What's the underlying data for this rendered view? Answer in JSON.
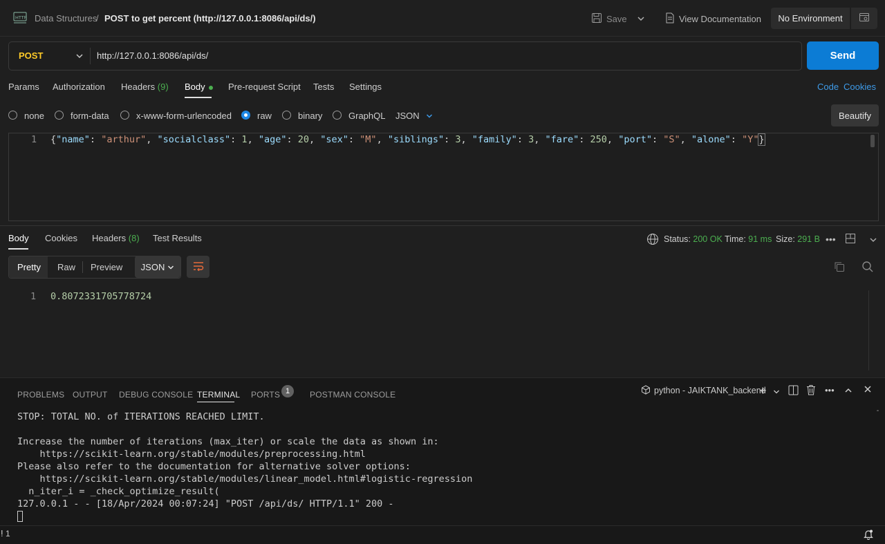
{
  "header": {
    "collection": "Data Structures",
    "separator": "/",
    "request_name": "POST to get percent (http://127.0.0.1:8086/api/ds/)",
    "save_label": "Save",
    "view_docs_label": "View Documentation",
    "environment": "No Environment"
  },
  "request": {
    "method": "POST",
    "url": "http://127.0.0.1:8086/api/ds/",
    "send_label": "Send"
  },
  "request_tabs": {
    "params": "Params",
    "authorization": "Authorization",
    "headers": "Headers",
    "headers_count": "(9)",
    "body": "Body",
    "prerequest": "Pre-request Script",
    "tests": "Tests",
    "settings": "Settings",
    "code": "Code",
    "cookies": "Cookies"
  },
  "body_types": {
    "none": "none",
    "form_data": "form-data",
    "urlencoded": "x-www-form-urlencoded",
    "raw": "raw",
    "binary": "binary",
    "graphql": "GraphQL",
    "format": "JSON",
    "beautify": "Beautify"
  },
  "editor": {
    "line_number": "1",
    "body": {
      "name": "arthur",
      "socialclass": 1,
      "age": 20,
      "sex": "M",
      "siblings": 3,
      "family": 3,
      "fare": 250,
      "port": "S",
      "alone": "Y"
    }
  },
  "response": {
    "tabs": {
      "body": "Body",
      "cookies": "Cookies",
      "headers": "Headers",
      "headers_count": "(8)",
      "test_results": "Test Results"
    },
    "status_label": "Status:",
    "status_value": "200 OK",
    "time_label": "Time:",
    "time_value": "91 ms",
    "size_label": "Size:",
    "size_value": "291 B",
    "views": {
      "pretty": "Pretty",
      "raw": "Raw",
      "preview": "Preview"
    },
    "format": "JSON",
    "line_number": "1",
    "value": "0.8072331705778724"
  },
  "panel": {
    "tabs": {
      "problems": "PROBLEMS",
      "output": "OUTPUT",
      "debug_console": "DEBUG CONSOLE",
      "terminal": "TERMINAL",
      "ports": "PORTS",
      "ports_count": "1",
      "postman_console": "POSTMAN CONSOLE"
    },
    "terminal_name": "python - JAIKTANK_backend",
    "lines": [
      "STOP: TOTAL NO. of ITERATIONS REACHED LIMIT.",
      "",
      "Increase the number of iterations (max_iter) or scale the data as shown in:",
      "    https://scikit-learn.org/stable/modules/preprocessing.html",
      "Please also refer to the documentation for alternative solver options:",
      "    https://scikit-learn.org/stable/modules/linear_model.html#logistic-regression",
      "  n_iter_i = _check_optimize_result(",
      "127.0.0.1 - - [18/Apr/2024 00:07:24] \"POST /api/ds/ HTTP/1.1\" 200 -"
    ]
  },
  "statusbar": {
    "count": "1"
  },
  "colors": {
    "accent": "#0c7cd5",
    "method": "#ffca28",
    "success": "#4caf50",
    "link": "#3e9be9"
  }
}
